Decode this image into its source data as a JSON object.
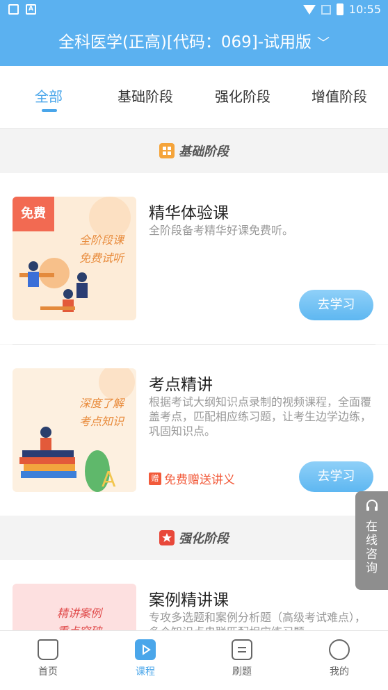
{
  "status": {
    "time": "10:55"
  },
  "header": {
    "title": "全科医学(正高)[代码：069]-试用版",
    "chevron": "﹀"
  },
  "tabs": [
    {
      "label": "全部"
    },
    {
      "label": "基础阶段"
    },
    {
      "label": "强化阶段"
    },
    {
      "label": "增值阶段"
    }
  ],
  "sections": [
    {
      "title": "基础阶段",
      "icon": "grid-icon"
    },
    {
      "title": "强化阶段",
      "icon": "star-icon"
    }
  ],
  "courses": [
    {
      "title": "精华体验课",
      "desc": "全阶段备考精华好课免费听。",
      "badge": "免费",
      "thumb_text": [
        "全阶段课",
        "免费试听"
      ],
      "button": "去学习"
    },
    {
      "title": "考点精讲",
      "desc": "根据考试大纲知识点录制的视频课程，全面覆盖考点，匹配相应练习题，让考生边学边练，巩固知识点。",
      "thumb_text": [
        "深度了解",
        "考点知识"
      ],
      "gift_icon": "赠",
      "gift": "免费赠送讲义",
      "button": "去学习"
    },
    {
      "title": "案例精讲课",
      "desc": "专攻多选题和案例分析题（高级考试难点），多个知识点串联匹配相应练习题",
      "thumb_text": [
        "精讲案例",
        "重点突破"
      ]
    }
  ],
  "consult": {
    "label": "在线咨询"
  },
  "bottom_nav": [
    {
      "label": "首页",
      "icon": "home-icon"
    },
    {
      "label": "课程",
      "icon": "play-icon"
    },
    {
      "label": "刷题",
      "icon": "paper-icon"
    },
    {
      "label": "我的",
      "icon": "user-icon"
    }
  ],
  "colors": {
    "primary": "#5bb1f0",
    "accent": "#4aa6ea",
    "red": "#f25a3a"
  }
}
